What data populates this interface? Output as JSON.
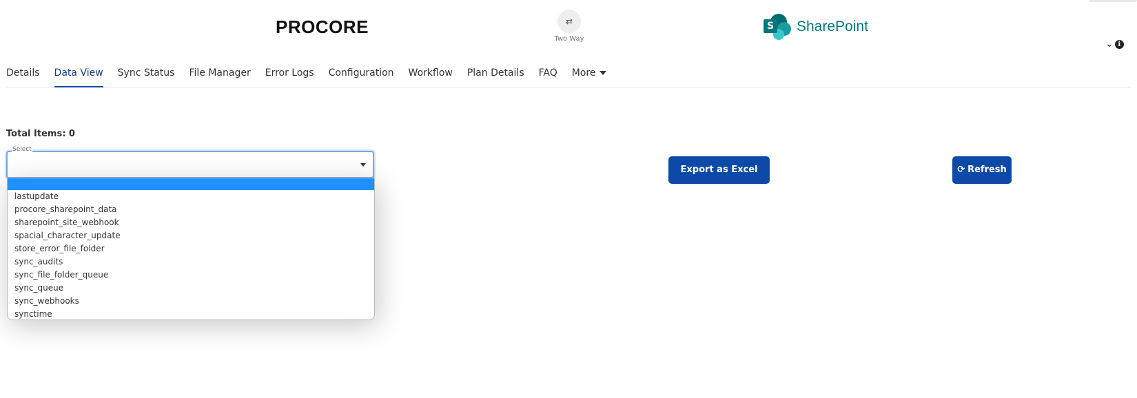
{
  "header": {
    "left_logo": "PROCORE",
    "sync_icon": "two-way-arrows-icon",
    "sync_label": "Two Way",
    "right_logo_letter": "S",
    "right_logo": "SharePoint",
    "collapse_icon": "chevron-down-icon",
    "info_icon": "info-icon"
  },
  "tabs": [
    {
      "label": "Details"
    },
    {
      "label": "Data View"
    },
    {
      "label": "Sync Status"
    },
    {
      "label": "File Manager"
    },
    {
      "label": "Error Logs"
    },
    {
      "label": "Configuration"
    },
    {
      "label": "Workflow"
    },
    {
      "label": "Plan Details"
    },
    {
      "label": "FAQ"
    },
    {
      "label": "More"
    }
  ],
  "active_tab": "Data View",
  "content": {
    "total_items_label": "Total Items: 0",
    "select_label": "Select",
    "select_value": "",
    "options": [
      "lastupdate",
      "procore_sharepoint_data",
      "sharepoint_site_webhook",
      "spacial_character_update",
      "store_error_file_folder",
      "sync_audits",
      "sync_file_folder_queue",
      "sync_queue",
      "sync_webhooks",
      "synctime"
    ],
    "export_button": "Export as Excel",
    "refresh_button": "Refresh"
  },
  "colors": {
    "primary": "#0d4aa8",
    "highlight": "#1e90ff",
    "sharepoint": "#03787c"
  }
}
